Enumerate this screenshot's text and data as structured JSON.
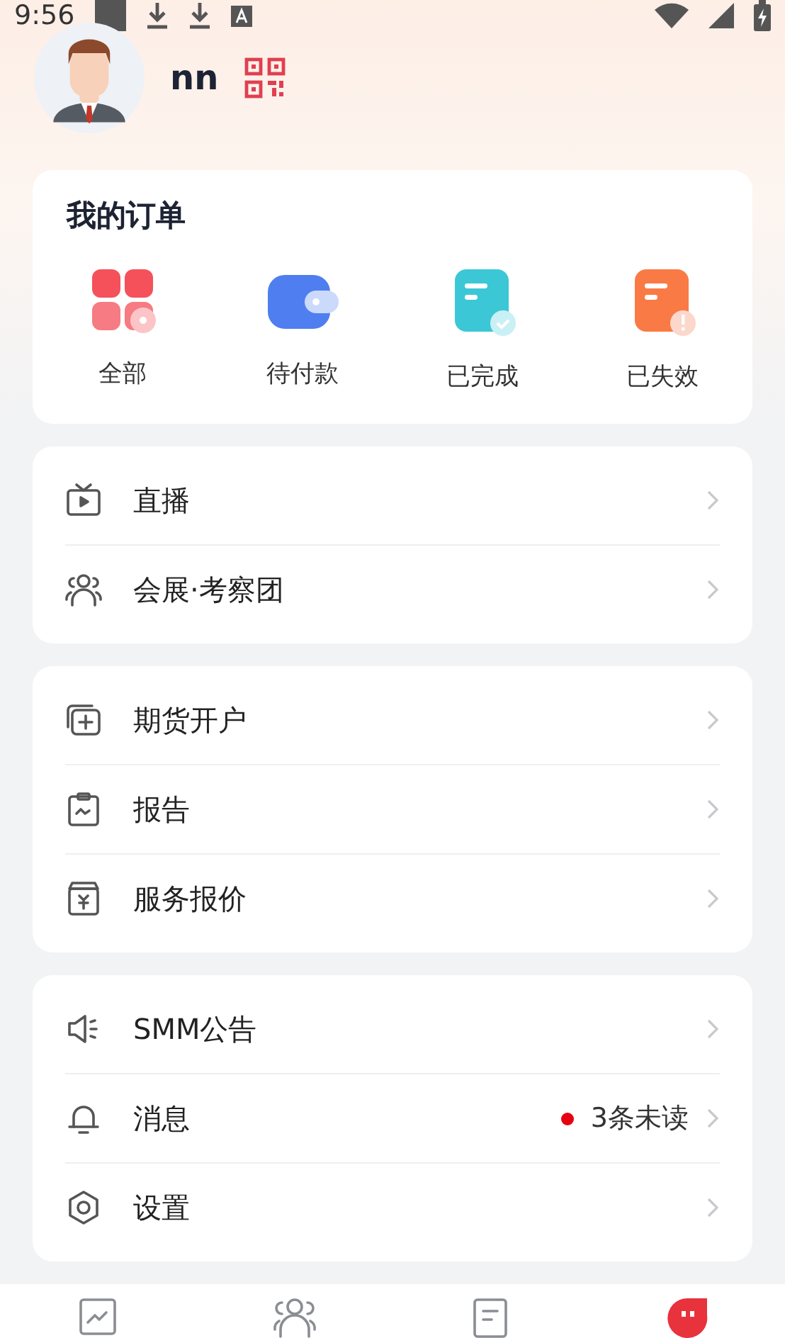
{
  "status_bar": {
    "time": "9:56"
  },
  "profile": {
    "username": "nn"
  },
  "orders": {
    "title": "我的订单",
    "items": [
      {
        "label": "全部"
      },
      {
        "label": "待付款"
      },
      {
        "label": "已完成"
      },
      {
        "label": "已失效"
      }
    ]
  },
  "menu_groups": [
    {
      "items": [
        {
          "label": "直播"
        },
        {
          "label": "会展·考察团"
        }
      ]
    },
    {
      "items": [
        {
          "label": "期货开户"
        },
        {
          "label": "报告"
        },
        {
          "label": "服务报价"
        }
      ]
    },
    {
      "items": [
        {
          "label": "SMM公告"
        },
        {
          "label": "消息",
          "badge": {
            "text": "3条未读",
            "color": "#e60012"
          }
        },
        {
          "label": "设置"
        }
      ]
    }
  ],
  "bottom_tabs": [
    {
      "selected": false
    },
    {
      "selected": false
    },
    {
      "selected": false
    },
    {
      "selected": true
    }
  ]
}
